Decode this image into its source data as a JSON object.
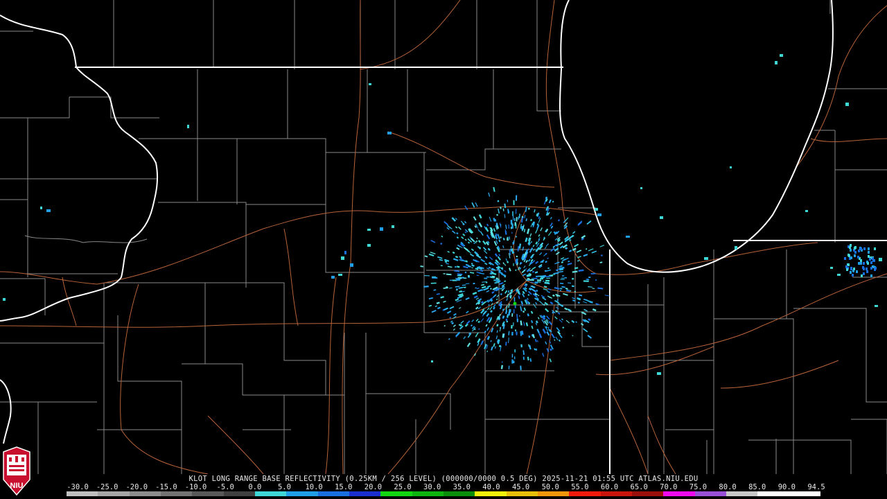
{
  "product": {
    "caption": "KLOT LONG RANGE BASE REFLECTIVITY (0.25KM / 256 LEVEL) (000000/0000 0.5 DEG) 2025-11-21 01:55 UTC  ATLAS.NIU.EDU"
  },
  "legend": {
    "labels": [
      "-30.0",
      "-25.0",
      "-20.0",
      "-15.0",
      "-10.0",
      "-5.0",
      "0.0",
      "5.0",
      "10.0",
      "15.0",
      "20.0",
      "25.0",
      "30.0",
      "35.0",
      "40.0",
      "45.0",
      "50.0",
      "55.0",
      "60.0",
      "65.0",
      "70.0",
      "75.0",
      "80.0",
      "85.0",
      "90.0",
      "94.5"
    ],
    "colors": [
      "#bfbfbf",
      "#a6a6a6",
      "#8c8c8c",
      "#737373",
      "#595959",
      "#404040",
      "#3fd6d6",
      "#1e9fe8",
      "#1a6fe0",
      "#1a2fd0",
      "#12d612",
      "#0fb50f",
      "#0a8f0a",
      "#f2f20a",
      "#e8c00a",
      "#f0960a",
      "#f21a0a",
      "#c8140a",
      "#9a0f0a",
      "#f00af0",
      "#9a4fd8",
      "#c8c8c8",
      "#ffffff",
      "#ffffff"
    ]
  },
  "logo": {
    "text": "NIU"
  },
  "colors": {
    "background": "#000000",
    "state_border": "#ffffff",
    "county_line": "#8a8a8a",
    "highway": "#b8643a"
  }
}
